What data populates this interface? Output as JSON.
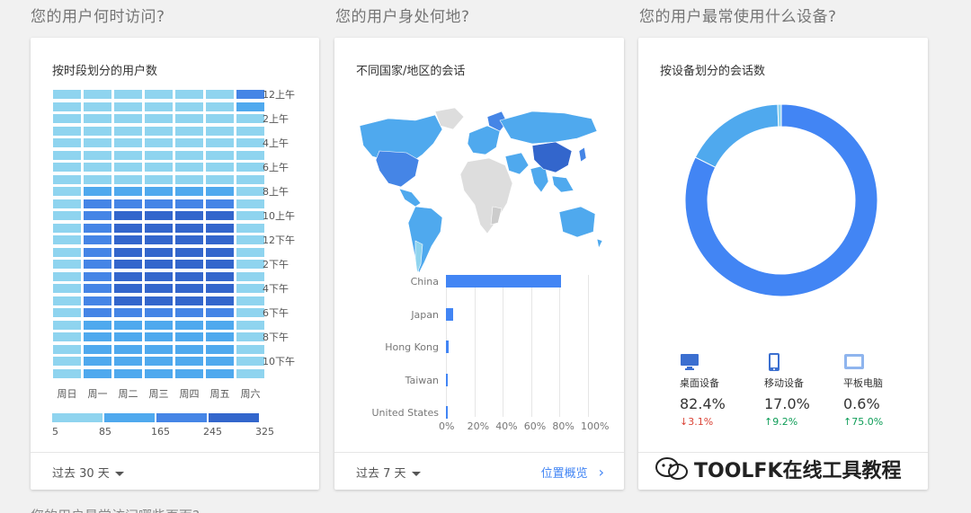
{
  "sections": {
    "when": "您的用户何时访问?",
    "where": "您的用户身处何地?",
    "device": "您的用户最常使用什么设备?"
  },
  "heatmap_card": {
    "title": "按时段划分的用户数",
    "hour_labels": [
      "12上午",
      "2上午",
      "4上午",
      "6上午",
      "8上午",
      "10上午",
      "12下午",
      "2下午",
      "4下午",
      "6下午",
      "8下午",
      "10下午"
    ],
    "day_labels": [
      "周日",
      "周一",
      "周二",
      "周三",
      "周四",
      "周五",
      "周六"
    ],
    "scale_labels": [
      "5",
      "85",
      "165",
      "245",
      "325"
    ],
    "scale_colors": [
      "#8fd4ef",
      "#4fa9ee",
      "#4585e6",
      "#3366cc"
    ],
    "footer_range": "过去 30 天"
  },
  "geo_card": {
    "title": "不同国家/地区的会话",
    "footer_range": "过去 7 天",
    "footer_link": "位置概览",
    "chart_data": {
      "type": "bar",
      "orientation": "horizontal",
      "categories": [
        "China",
        "Japan",
        "Hong Kong",
        "Taiwan",
        "United States"
      ],
      "values": [
        81,
        5,
        2,
        1.5,
        1.2
      ],
      "xlim": [
        0,
        100
      ],
      "x_tick_labels": [
        "0%",
        "20%",
        "40%",
        "60%",
        "80%",
        "100%"
      ],
      "color": "#4285f4"
    }
  },
  "device_card": {
    "title": "按设备划分的会话数",
    "chart_data": {
      "type": "pie",
      "style": "donut",
      "categories": [
        "桌面设备",
        "移动设备",
        "平板电脑"
      ],
      "values": [
        82.4,
        17.0,
        0.6
      ],
      "colors": [
        "#4285f4",
        "#4fa9ee",
        "#8fd4ef"
      ]
    },
    "devices": [
      {
        "name": "桌面设备",
        "value": "82.4%",
        "change": "↓3.1%",
        "change_color": "#db4437",
        "icon": "desktop-icon"
      },
      {
        "name": "移动设备",
        "value": "17.0%",
        "change": "↑9.2%",
        "change_color": "#0f9d58",
        "icon": "mobile-icon"
      },
      {
        "name": "平板电脑",
        "value": "0.6%",
        "change": "↑75.0%",
        "change_color": "#0f9d58",
        "icon": "tablet-icon"
      }
    ]
  },
  "watermark": "TOOLFK在线工具教程",
  "bottom_title": "您的用户最常访问哪些页面?"
}
